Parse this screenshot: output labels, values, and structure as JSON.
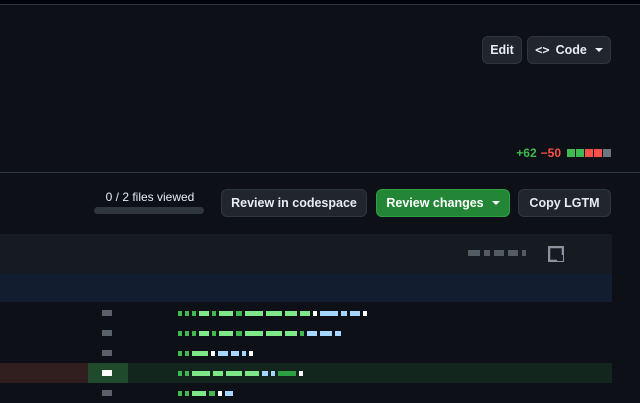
{
  "header": {
    "edit_label": "Edit",
    "code_label": "Code",
    "code_icon": "code-icon"
  },
  "diffstat": {
    "additions": "+62",
    "deletions": "−50",
    "blocks": [
      "#3fb950",
      "#3fb950",
      "#f85149",
      "#f85149",
      "#6e7681"
    ]
  },
  "review_bar": {
    "files_viewed_label": "0 / 2 files viewed",
    "files_viewed_fraction": 0,
    "review_in_codespace_label": "Review in codespace",
    "review_changes_label": "Review changes",
    "copy_lgtm_label": "Copy LGTM"
  },
  "colors": {
    "accent_green": "#238636",
    "addition": "#3fb950",
    "deletion": "#f85149",
    "background": "#0d1117"
  }
}
